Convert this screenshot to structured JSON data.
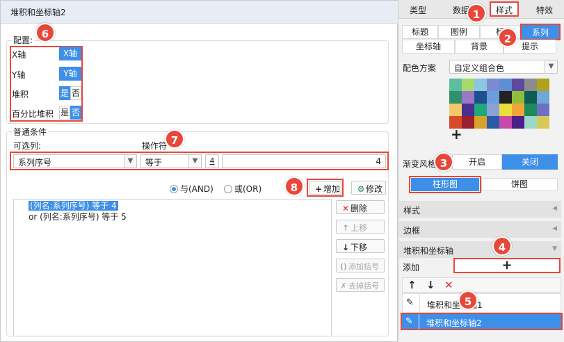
{
  "dialog": {
    "title": "堆积和坐标轴2",
    "config": {
      "label": "配置:",
      "x_axis": {
        "label": "X轴",
        "value": "X轴"
      },
      "y_axis": {
        "label": "Y轴",
        "value": "Y轴"
      },
      "stacked": {
        "label": "堆积",
        "yes": "是",
        "no": "否",
        "selected": "是"
      },
      "percent_stacked": {
        "label": "百分比堆积",
        "yes": "是",
        "no": "否",
        "selected": "否"
      }
    },
    "condition": {
      "label": "普通条件",
      "column_label": "可选列:",
      "operator_label": "操作符",
      "column_value": "系列序号",
      "operator_value": "等于",
      "value_type_icon": "4",
      "value": "4",
      "logic_and": "与(AND)",
      "logic_or": "或(OR)",
      "logic_selected": "AND",
      "add_label": "增加",
      "modify_label": "修改",
      "delete_label": "删除",
      "move_up_label": "上移",
      "move_down_label": "下移",
      "add_bracket_label": "添加括号",
      "remove_bracket_label": "去掉括号",
      "items": [
        "(列名:系列序号) 等于 4",
        "or (列名:系列序号) 等于 5"
      ]
    }
  },
  "panel": {
    "tabs": [
      "类型",
      "数据",
      "样式",
      "特效"
    ],
    "active_tab": "样式",
    "subtabs_row1": [
      "标题",
      "图例",
      "标",
      "系列"
    ],
    "subtabs_row2": [
      "坐标轴",
      "背景",
      "提示"
    ],
    "active_subtab": "系列",
    "color_scheme_label": "配色方案",
    "color_scheme_value": "自定义组合色",
    "palette": [
      [
        "#5bbf9e",
        "#a6d96a",
        "#8bc5e0",
        "#7c8bd1",
        "#5e8ed6",
        "#5c4a9c",
        "#8c8c8c",
        "#b0a11f"
      ],
      [
        "#2f8f6f",
        "#9a77c7",
        "#1f4f8f",
        "#6a9fdc",
        "#222222",
        "#8fbe3a",
        "#0f5c55",
        "#6ea8d8"
      ],
      [
        "#f2c86a",
        "#4a2f8f",
        "#1fa87a",
        "#8da0d8",
        "#e8e03a",
        "#f2a33a",
        "#1f8a5c",
        "#6f6fc2"
      ],
      [
        "#d94a2a",
        "#9a1f2f",
        "#d8a32a",
        "#2a5aa8",
        "#c84aa8",
        "#4a1f8a",
        "#9ad8c8",
        "#d8c85a"
      ]
    ],
    "add_color_symbol": "+",
    "gradient_label": "渐变风格",
    "gradient_on": "开启",
    "gradient_off": "关闭",
    "gradient_selected": "关闭",
    "chart_bar": "柱形图",
    "chart_pie": "饼图",
    "chart_selected": "柱形图",
    "section_style": "样式",
    "section_border": "边框",
    "section_stack_axis": "堆积和坐标轴",
    "add_label": "添加",
    "add_symbol": "+",
    "list_items": [
      "堆积和坐标轴1",
      "堆积和坐标轴2"
    ],
    "list_selected": "堆积和坐标轴2"
  },
  "badges": [
    "1",
    "2",
    "3",
    "4",
    "5",
    "6",
    "7",
    "8"
  ],
  "colors": {
    "accent": "#3d8fe8",
    "highlight": "#e8473a",
    "title_bar": "#e7ecf5"
  }
}
